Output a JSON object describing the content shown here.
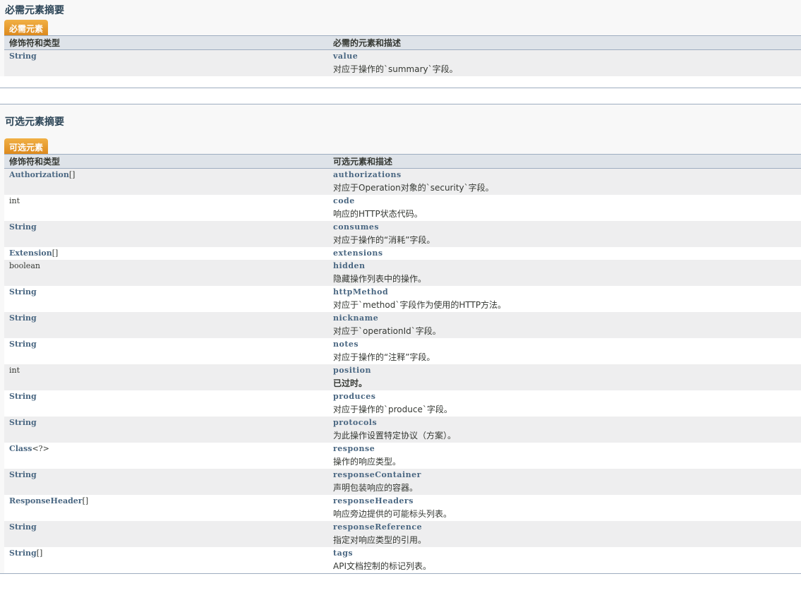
{
  "required": {
    "title": "必需元素摘要",
    "caption": "必需元素",
    "col_type": "修饰符和类型",
    "col_desc": "必需的元素和描述",
    "rows": [
      {
        "type": "String",
        "type_suffix": "",
        "link": true,
        "name": "value",
        "desc": "对应于操作的`summary`字段。"
      }
    ]
  },
  "optional": {
    "title": "可选元素摘要",
    "caption": "可选元素",
    "col_type": "修饰符和类型",
    "col_desc": "可选元素和描述",
    "rows": [
      {
        "type": "Authorization",
        "type_suffix": "[]",
        "link": true,
        "name": "authorizations",
        "desc": "对应于Operation对象的`security`字段。"
      },
      {
        "type": "int",
        "type_suffix": "",
        "link": false,
        "name": "code",
        "desc": "响应的HTTP状态代码。"
      },
      {
        "type": "String",
        "type_suffix": "",
        "link": true,
        "name": "consumes",
        "desc": "对应于操作的“消耗”字段。"
      },
      {
        "type": "Extension",
        "type_suffix": "[]",
        "link": true,
        "name": "extensions",
        "desc": ""
      },
      {
        "type": "boolean",
        "type_suffix": "",
        "link": false,
        "name": "hidden",
        "desc": "隐藏操作列表中的操作。"
      },
      {
        "type": "String",
        "type_suffix": "",
        "link": true,
        "name": "httpMethod",
        "desc": "对应于`method`字段作为使用的HTTP方法。"
      },
      {
        "type": "String",
        "type_suffix": "",
        "link": true,
        "name": "nickname",
        "desc": "对应于`operationId`字段。"
      },
      {
        "type": "String",
        "type_suffix": "",
        "link": true,
        "name": "notes",
        "desc": "对应于操作的“注释”字段。"
      },
      {
        "type": "int",
        "type_suffix": "",
        "link": false,
        "name": "position",
        "desc": "已过时。",
        "bold": true
      },
      {
        "type": "String",
        "type_suffix": "",
        "link": true,
        "name": "produces",
        "desc": "对应于操作的`produce`字段。"
      },
      {
        "type": "String",
        "type_suffix": "",
        "link": true,
        "name": "protocols",
        "desc": "为此操作设置特定协议（方案）。"
      },
      {
        "type": "Class",
        "type_suffix": "<?>",
        "link": true,
        "name": "response",
        "desc": "操作的响应类型。"
      },
      {
        "type": "String",
        "type_suffix": "",
        "link": true,
        "name": "responseContainer",
        "desc": "声明包装响应的容器。"
      },
      {
        "type": "ResponseHeader",
        "type_suffix": "[]",
        "link": true,
        "name": "responseHeaders",
        "desc": "响应旁边提供的可能标头列表。"
      },
      {
        "type": "String",
        "type_suffix": "",
        "link": true,
        "name": "responseReference",
        "desc": "指定对响应类型的引用。"
      },
      {
        "type": "String",
        "type_suffix": "[]",
        "link": true,
        "name": "tags",
        "desc": "API文档控制的标记列表。"
      }
    ]
  }
}
